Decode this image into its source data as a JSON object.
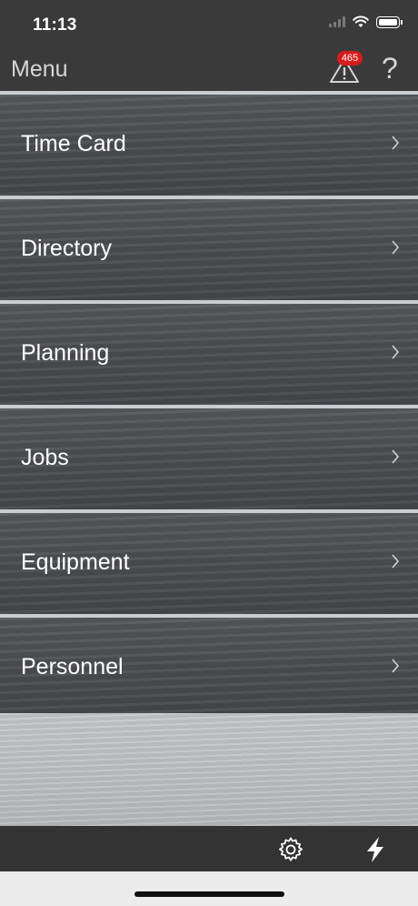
{
  "status": {
    "time": "11:13"
  },
  "nav": {
    "title": "Menu",
    "alert_count": "465",
    "help_label": "?"
  },
  "menu": {
    "items": [
      {
        "label": "Time Card"
      },
      {
        "label": "Directory"
      },
      {
        "label": "Planning"
      },
      {
        "label": "Jobs"
      },
      {
        "label": "Equipment"
      },
      {
        "label": "Personnel"
      }
    ]
  },
  "colors": {
    "bar": "#3a3a3a",
    "badge": "#d81b1b",
    "divider": "#c9cdcf"
  },
  "icons": [
    "wifi-icon",
    "battery-icon",
    "alert-triangle-icon",
    "help-icon",
    "chevron-right-icon",
    "gear-icon",
    "lightning-icon"
  ]
}
